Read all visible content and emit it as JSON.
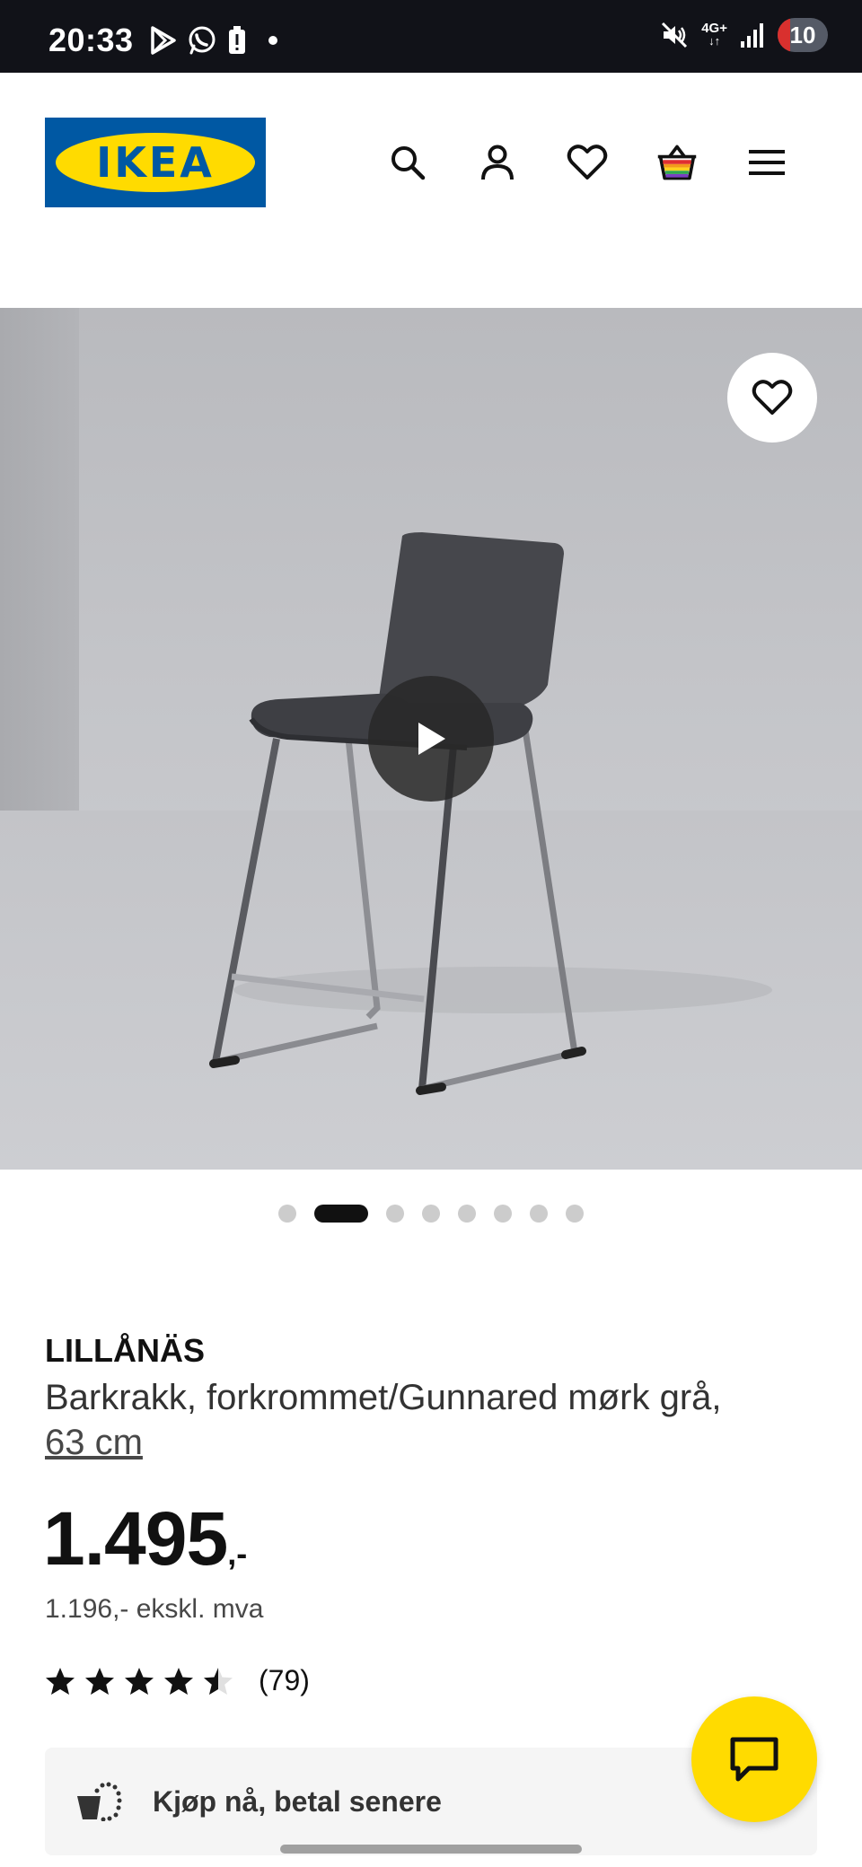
{
  "status_bar": {
    "time": "20:33",
    "network": "4G+",
    "battery": "10"
  },
  "header": {
    "logo_text": "IKEA",
    "icons": [
      "search-icon",
      "account-icon",
      "favorites-icon",
      "cart-icon",
      "menu-icon"
    ]
  },
  "gallery": {
    "image_count": 8,
    "active_index": 1,
    "has_video": true
  },
  "product": {
    "name": "LILLÅNÄS",
    "description": "Barkrakk, forkrommet/Gunnared mørk grå,",
    "size": "63 cm",
    "price": "1.495",
    "price_suffix": ",-",
    "price_ex_vat": "1.196,- ekskl. mva",
    "rating": 4.5,
    "rating_count": "(79)"
  },
  "bnpl": {
    "label": "Kjøp nå, betal senere"
  },
  "colors": {
    "ikea_blue": "#0058a3",
    "ikea_yellow": "#ffdb00"
  }
}
